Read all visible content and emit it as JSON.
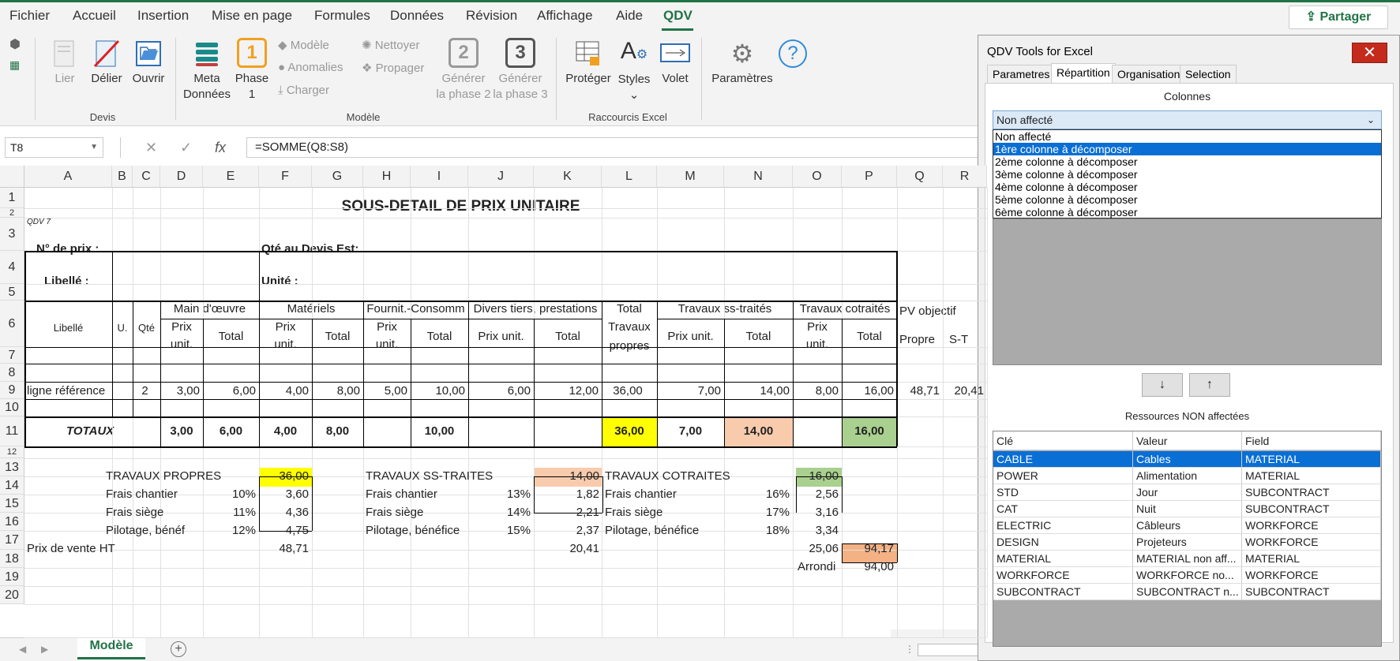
{
  "menu": {
    "items": [
      "Fichier",
      "Accueil",
      "Insertion",
      "Mise en page",
      "Formules",
      "Données",
      "Révision",
      "Affichage",
      "Aide",
      "QDV"
    ],
    "share": "Partager"
  },
  "ribbon": {
    "lier": "Lier",
    "delier": "Délier",
    "ouvrir": "Ouvrir",
    "group_devis": "Devis",
    "meta1": "Meta",
    "meta2": "Données",
    "phase1a": "Phase",
    "phase1b": "1",
    "phase1_num": "1",
    "modele": "Modèle",
    "anomalies": "Anomalies",
    "charger": "Charger",
    "nettoyer": "Nettoyer",
    "propager": "Propager",
    "gen2a": "Générer",
    "gen2b": "la phase 2",
    "gen2_num": "2",
    "gen3a": "Générer",
    "gen3b": "la phase 3",
    "gen3_num": "3",
    "group_modele": "Modèle",
    "proteger": "Protéger",
    "styles": "Styles",
    "volet": "Volet",
    "group_raccourcis": "Raccourcis Excel",
    "parametres": "Paramètres"
  },
  "formula": {
    "namebox": "T8",
    "fx": "fx",
    "text": "=SOMME(Q8:S8)"
  },
  "columns": [
    "A",
    "B",
    "C",
    "D",
    "E",
    "F",
    "G",
    "H",
    "I",
    "J",
    "K",
    "L",
    "M",
    "N",
    "O",
    "P",
    "Q",
    "R"
  ],
  "rows": [
    "1",
    "2",
    "3",
    "4",
    "5",
    "6",
    "7",
    "8",
    "9",
    "10",
    "11",
    "12",
    "13",
    "14",
    "15",
    "16",
    "17",
    "18",
    "19",
    "20"
  ],
  "sheet": {
    "title": "SOUS-DETAIL DE PRIX UNITAIRE",
    "qdv7": "QDV 7",
    "n_prix": "N° de prix :",
    "qte_devis": "Qté au Devis Est:",
    "libelle_lbl": "Libellé :",
    "unite": "Unité :",
    "h_libelle": "Libellé",
    "h_u": "U.",
    "h_qte": "Qté",
    "h_mo": "Main d'œuvre",
    "h_mat": "Matériels",
    "h_four": "Fournit.-Consomm",
    "h_div": "Divers tiers, prestations",
    "h_total1": "Total",
    "h_total2": "Travaux",
    "h_total3": "propres",
    "h_sst": "Travaux ss-traités",
    "h_cot": "Travaux cotraités",
    "h_pv": "PV objectif",
    "prix": "Prix",
    "unit": "unit.",
    "total": "Total",
    "prixunit": "Prix unit.",
    "propre": "Propre",
    "st": "S-T",
    "r8": [
      "ligne référence",
      "2",
      "3,00",
      "6,00",
      "4,00",
      "8,00",
      "5,00",
      "10,00",
      "6,00",
      "12,00",
      "36,00",
      "7,00",
      "14,00",
      "8,00",
      "16,00",
      "48,71",
      "20,41"
    ],
    "totaux": "TOTAUX",
    "r10": [
      "3,00",
      "6,00",
      "4,00",
      "8,00",
      "10,00",
      "36,00",
      "7,00",
      "14,00",
      "16,00"
    ],
    "tp": "TRAVAUX PROPRES",
    "tp_v": "36,00",
    "fc": "Frais chantier",
    "fc_p": "10%",
    "fc_v": "3,60",
    "fs": "Frais siège",
    "fs_p": "11%",
    "fs_v": "4,36",
    "pb": "Pilotage, bénéf",
    "pb_p": "12%",
    "pb_v": "4,75",
    "pv": "Prix de vente HT",
    "pv_v": "48,71",
    "sst": "TRAVAUX SS-TRAITES",
    "sst_v": "14,00",
    "fc2": "Frais chantier",
    "fc2_p": "13%",
    "fc2_v": "1,82",
    "fs2": "Frais siège",
    "fs2_p": "14%",
    "fs2_v": "2,21",
    "pb2": "Pilotage, bénéfice",
    "pb2_p": "15%",
    "pb2_v": "2,37",
    "pv2_v": "20,41",
    "cot": "TRAVAUX COTRAITES",
    "cot_v": "16,00",
    "fc3": "Frais chantier",
    "fc3_p": "16%",
    "fc3_v": "2,56",
    "fs3": "Frais siège",
    "fs3_p": "17%",
    "fs3_v": "3,16",
    "pb3": "Pilotage, bénéfice",
    "pb3_p": "18%",
    "pb3_v": "3,34",
    "pv3_v": "25,06",
    "grand": "94,17",
    "arrondi": "Arrondi",
    "arrondi_v": "94,00",
    "tab": "Modèle"
  },
  "panel": {
    "title": "QDV Tools for Excel",
    "close": "✕",
    "tabs": [
      "Parametres",
      "Répartition",
      "Organisation",
      "Selection"
    ],
    "colonnes": "Colonnes",
    "selected": "Non affecté",
    "options": [
      "Non affecté",
      "1ère colonne à décomposer",
      "2ème colonne à décomposer",
      "3ème colonne à décomposer",
      "4ème colonne à décomposer",
      "5ème colonne à décomposer",
      "6ème colonne à décomposer"
    ],
    "down": "↓",
    "up": "↑",
    "res_title": "Ressources NON affectées",
    "headers": [
      "Clé",
      "Valeur",
      "Field"
    ],
    "rows": [
      [
        "CABLE",
        "Cables",
        "MATERIAL"
      ],
      [
        "POWER",
        "Alimentation",
        "MATERIAL"
      ],
      [
        "STD",
        "Jour",
        "SUBCONTRACT"
      ],
      [
        "CAT",
        "Nuit",
        "SUBCONTRACT"
      ],
      [
        "ELECTRIC",
        "Câbleurs",
        "WORKFORCE"
      ],
      [
        "DESIGN",
        "Projeteurs",
        "WORKFORCE"
      ],
      [
        "MATERIAL",
        "MATERIAL non aff...",
        "MATERIAL"
      ],
      [
        "WORKFORCE",
        "WORKFORCE no...",
        "WORKFORCE"
      ],
      [
        "SUBCONTRACT",
        "SUBCONTRACT n...",
        "SUBCONTRACT"
      ]
    ]
  },
  "colors": {
    "accent": "#217346",
    "yellow": "#ffff00",
    "peach": "#f8cbad",
    "green": "#a9d08e",
    "orange": "#f4b183",
    "select": "#0a6fd4"
  }
}
